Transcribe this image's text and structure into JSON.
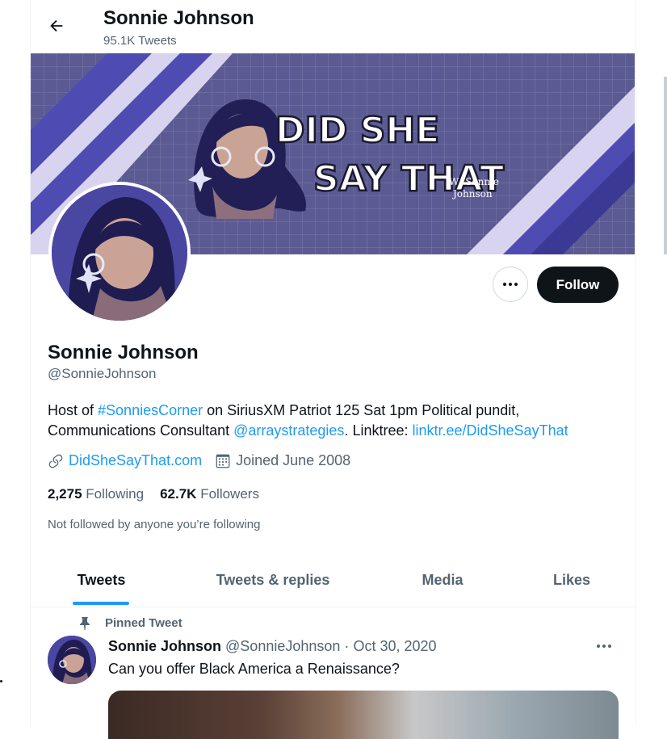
{
  "header": {
    "name": "Sonnie Johnson",
    "tweet_count": "95.1K Tweets"
  },
  "banner": {
    "line1": "DID SHE",
    "line2": "SAY THAT",
    "tag1": "W/ Sonnie",
    "tag2": "Johnson"
  },
  "actions": {
    "follow_label": "Follow"
  },
  "profile": {
    "name": "Sonnie Johnson",
    "handle": "@SonnieJohnson",
    "bio": {
      "p1": "Host of ",
      "hashtag": "#SonniesCorner",
      "p2": " on SiriusXM Patriot 125 Sat 1pm  Political pundit, Communications Consultant ",
      "mention": "@arraystrategies",
      "p3": ". Linktree: ",
      "link": "linktr.ee/DidSheSayThat"
    },
    "website": "DidSheSayThat.com",
    "joined": "Joined June 2008",
    "following_count": "2,275",
    "following_label": "Following",
    "followers_count": "62.7K",
    "followers_label": "Followers",
    "not_followed": "Not followed by anyone you’re following"
  },
  "tabs": [
    {
      "label": "Tweets",
      "active": true
    },
    {
      "label": "Tweets & replies",
      "active": false
    },
    {
      "label": "Media",
      "active": false
    },
    {
      "label": "Likes",
      "active": false
    }
  ],
  "pinned_tweet": {
    "pinned_label": "Pinned Tweet",
    "author": "Sonnie Johnson",
    "handle": "@SonnieJohnson",
    "separator": "·",
    "date": "Oct 30, 2020",
    "text": "Can you offer Black America a Renaissance?"
  },
  "colors": {
    "accent": "#1d9bf0",
    "text": "#0f1419",
    "muted": "#536471",
    "banner": "#5c5a93"
  },
  "icons": [
    "back-arrow-icon",
    "more-icon",
    "link-icon",
    "calendar-icon",
    "pin-icon"
  ]
}
